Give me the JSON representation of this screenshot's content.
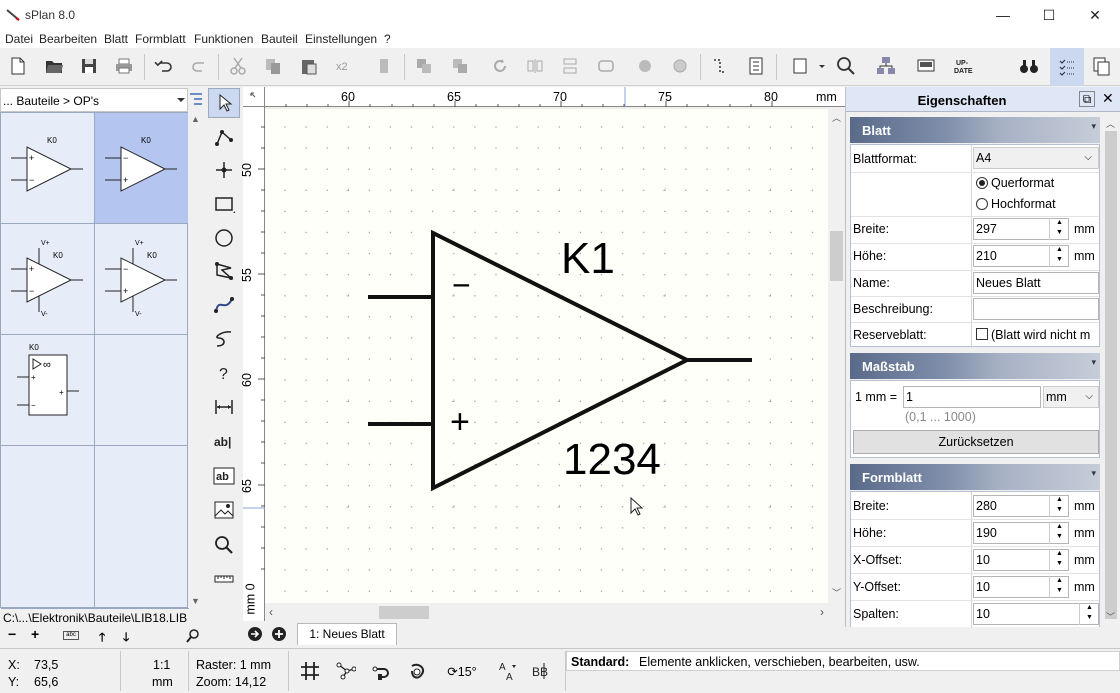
{
  "app": {
    "title": "sPlan 8.0"
  },
  "menu": [
    "Datei",
    "Bearbeiten",
    "Blatt",
    "Formblatt",
    "Funktionen",
    "Bauteil",
    "Einstellungen",
    "?"
  ],
  "library": {
    "combo": "... Bauteile > OP's",
    "path": "C:\\...\\Elektronik\\Bauteile\\LIB18.LIB",
    "cells": [
      {
        "label": "K0",
        "supply": false
      },
      {
        "label": "K0",
        "supply": false,
        "selected": true
      },
      {
        "label": "K0",
        "supply": true,
        "vplus": "V+",
        "vminus": "V-"
      },
      {
        "label": "K0",
        "supply": true,
        "vplus": "V+",
        "vminus": "V-"
      },
      {
        "label": "K0",
        "block": true
      }
    ]
  },
  "ruler": {
    "top_labels": [
      "60",
      "65",
      "70",
      "75",
      "80"
    ],
    "top_unit": "mm",
    "left_labels": [
      "50",
      "55",
      "60",
      "65",
      "0"
    ],
    "left_unit": "mm"
  },
  "canvas": {
    "ref": "K1",
    "value": "1234",
    "minus": "−",
    "plus": "+"
  },
  "tabs": {
    "sheet": "1: Neues Blatt"
  },
  "properties": {
    "title": "Eigenschaften",
    "blatt": {
      "title": "Blatt",
      "format_label": "Blattformat:",
      "format_value": "A4",
      "orientation_landscape": "Querformat",
      "orientation_portrait": "Hochformat",
      "width_label": "Breite:",
      "width_value": "297",
      "height_label": "Höhe:",
      "height_value": "210",
      "unit": "mm",
      "name_label": "Name:",
      "name_value": "Neues Blatt",
      "desc_label": "Beschreibung:",
      "desc_value": "",
      "reserve_label": "Reserveblatt:",
      "reserve_text": "(Blatt wird nicht m"
    },
    "massstab": {
      "title": "Maßstab",
      "prefix": "1 mm =",
      "value": "1",
      "unit": "mm",
      "range": "(0,1 ... 1000)",
      "reset": "Zurücksetzen"
    },
    "formblatt": {
      "title": "Formblatt",
      "width_label": "Breite:",
      "width_value": "280",
      "height_label": "Höhe:",
      "height_value": "190",
      "xoff_label": "X-Offset:",
      "xoff_value": "10",
      "yoff_label": "Y-Offset:",
      "yoff_value": "10",
      "cols_label": "Spalten:",
      "cols_value": "10",
      "unit": "mm"
    }
  },
  "status": {
    "x_label": "X:",
    "x_value": "73,5",
    "y_label": "Y:",
    "y_value": "65,6",
    "scale": "1:1",
    "scale_unit": "mm",
    "raster": "Raster: 1 mm",
    "zoom": "Zoom: 14,12",
    "rotate": "15°",
    "mode": "Standard:",
    "hint": "Elemente anklicken, verschieben, bearbeiten, usw."
  },
  "colors": {
    "accent_selected": "#b4c5f0",
    "grid_bg": "#e6ecf8",
    "section_head": "#5a6a8a"
  }
}
